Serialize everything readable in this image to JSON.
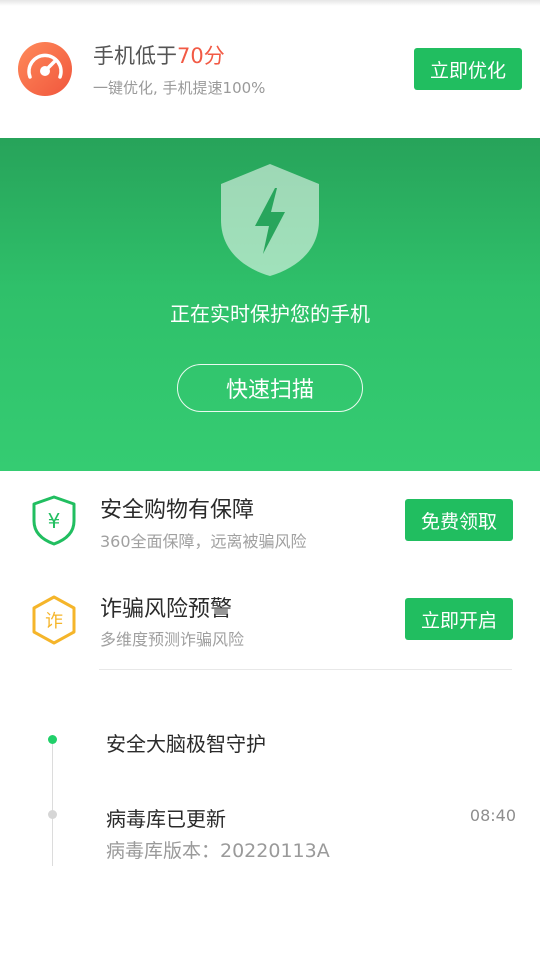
{
  "header": {
    "title_prefix": "手机低于",
    "score": "70分",
    "subtitle": "一键优化, 手机提速100%",
    "button_label": "立即优化",
    "gauge_icon": "speedometer-icon",
    "score_color": "#f25a45"
  },
  "hero": {
    "shield_icon": "lightning-shield-icon",
    "status_text": "正在实时保护您的手机",
    "scan_button": "快速扫描",
    "background_color": "#2fc06a"
  },
  "features": [
    {
      "icon": "yuan-shield-icon",
      "title": "安全购物有保障",
      "subtitle": "360全面保障，远离被骗风险",
      "button": "免费领取",
      "icon_glyph": "¥",
      "icon_color": "#21be60"
    },
    {
      "icon": "fraud-hexagon-icon",
      "title": "诈骗风险预警",
      "subtitle": "多维度预测诈骗风险",
      "button": "立即开启",
      "icon_glyph": "诈",
      "icon_color": "#f5b52a"
    }
  ],
  "timeline": [
    {
      "title": "安全大脑极智守护",
      "subtitle": "",
      "time": ""
    },
    {
      "title": "病毒库已更新",
      "subtitle": "病毒库版本：20220113A",
      "time": "08:40"
    }
  ],
  "colors": {
    "accent_green": "#21be60",
    "warning_orange": "#f25a45",
    "timeline_active": "#21d06a"
  }
}
